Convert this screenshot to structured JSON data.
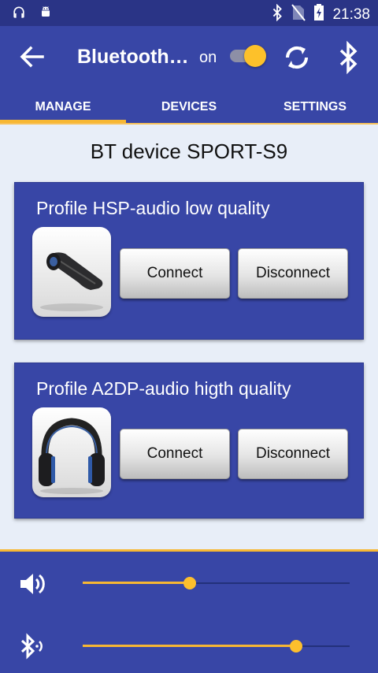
{
  "status_bar": {
    "time": "21:38",
    "left_icons": [
      "headphones-icon",
      "android-icon"
    ],
    "right_icons": [
      "bluetooth-icon",
      "no-sim-icon",
      "battery-charging-icon"
    ]
  },
  "app_bar": {
    "title": "Bluetooth…",
    "toggle_label": "on",
    "toggle_state": true,
    "icons": [
      "back-arrow-icon",
      "refresh-icon",
      "bluetooth-icon"
    ]
  },
  "tabs": [
    {
      "label": "MANAGE",
      "active": true
    },
    {
      "label": "DEVICES",
      "active": false
    },
    {
      "label": "SETTINGS",
      "active": false
    }
  ],
  "device_title": "BT device SPORT-S9",
  "profiles": [
    {
      "title": "Profile HSP-audio low quality",
      "icon": "headset-icon",
      "connect_label": "Connect",
      "disconnect_label": "Disconnect"
    },
    {
      "title": "Profile A2DP-audio higth quality",
      "icon": "headphones-icon",
      "connect_label": "Connect",
      "disconnect_label": "Disconnect"
    }
  ],
  "sliders": [
    {
      "icon": "volume-icon",
      "value": 0.4
    },
    {
      "icon": "bluetooth-audio-icon",
      "value": 0.8
    }
  ],
  "colors": {
    "primary": "#3846a6",
    "primary_dark": "#2a3486",
    "accent": "#f7b733",
    "background": "#e8eef8"
  }
}
